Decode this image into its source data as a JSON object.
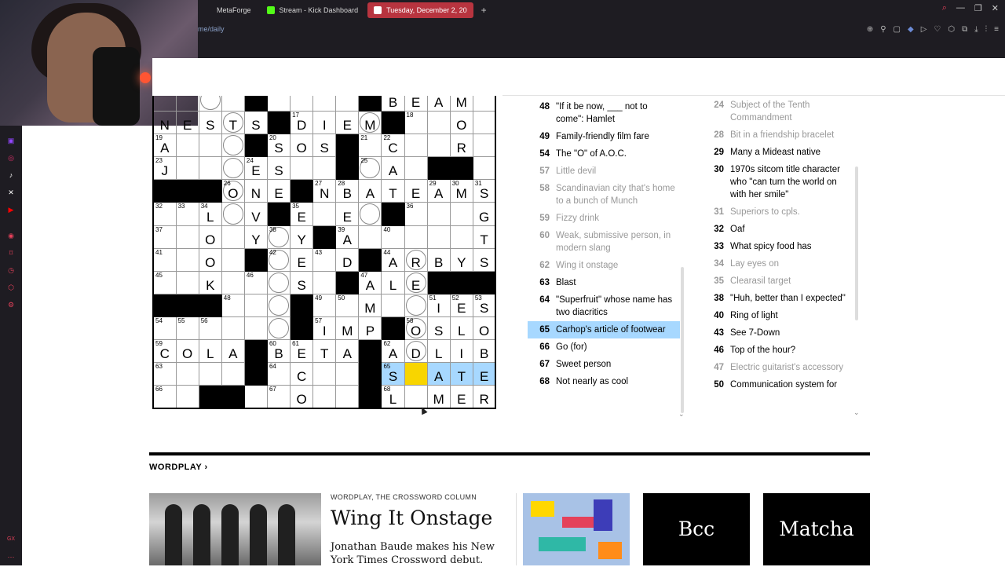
{
  "browser": {
    "tabs": [
      {
        "label": "MetaForge",
        "active": false,
        "icon": "page-icon"
      },
      {
        "label": "Stream - Kick Dashboard",
        "active": false,
        "icon": "kick-icon"
      },
      {
        "label": "Tuesday, December 2, 20",
        "active": true,
        "icon": "nyt-icon"
      }
    ],
    "url": "me/daily",
    "accent_color": "#b8343f"
  },
  "grid": {
    "rows": [
      [
        "",
        "O",
        "",
        "B",
        "",
        "",
        "",
        "",
        "B",
        "E",
        "A",
        "M"
      ],
      [
        "N|E",
        "S",
        "T|O",
        "S",
        "#",
        "D|17",
        "I",
        "E",
        "M|O",
        "#",
        "|18",
        "O"
      ],
      [
        "A|19",
        "",
        "O",
        "#",
        "S|20",
        "O",
        "S",
        "#|21",
        "C|22",
        "",
        "",
        "R"
      ],
      [
        "J|23",
        "",
        "O",
        "E|24",
        "S",
        "",
        "",
        "#",
        "A|25",
        "",
        "#",
        "#"
      ],
      [
        "#",
        "#",
        "#",
        "O|26",
        "N",
        "E",
        "#",
        "N|27",
        "B|28",
        "A",
        "T",
        "E",
        "A|29",
        "M|30",
        "S|31"
      ],
      [
        "",
        "",
        "",
        "",
        "",
        "",
        "",
        "",
        "",
        "",
        "",
        ""
      ]
    ],
    "active_clue_number": "65",
    "active_answer_visible": [
      "S",
      "",
      "A",
      "T",
      "E"
    ]
  },
  "across_clues": [
    {
      "num": "48",
      "text": "\"If it be now, ___ not to come\": Hamlet",
      "state": "normal"
    },
    {
      "num": "49",
      "text": "Family-friendly film fare",
      "state": "normal"
    },
    {
      "num": "54",
      "text": "The \"O\" of A.O.C.",
      "state": "normal"
    },
    {
      "num": "57",
      "text": "Little devil",
      "state": "dim"
    },
    {
      "num": "58",
      "text": "Scandinavian city that's home to a bunch of Munch",
      "state": "dim"
    },
    {
      "num": "59",
      "text": "Fizzy drink",
      "state": "dim"
    },
    {
      "num": "60",
      "text": "Weak, submissive person, in modern slang",
      "state": "dim"
    },
    {
      "num": "62",
      "text": "Wing it onstage",
      "state": "dim"
    },
    {
      "num": "63",
      "text": "Blast",
      "state": "normal"
    },
    {
      "num": "64",
      "text": "\"Superfruit\" whose name has two diacritics",
      "state": "normal"
    },
    {
      "num": "65",
      "text": "Carhop's article of footwear",
      "state": "selected"
    },
    {
      "num": "66",
      "text": "Go (for)",
      "state": "normal"
    },
    {
      "num": "67",
      "text": "Sweet person",
      "state": "normal"
    },
    {
      "num": "68",
      "text": "Not nearly as cool",
      "state": "normal"
    }
  ],
  "down_clues": [
    {
      "num": "24",
      "text": "Subject of the Tenth Commandment",
      "state": "dim"
    },
    {
      "num": "28",
      "text": "Bit in a friendship bracelet",
      "state": "dim"
    },
    {
      "num": "29",
      "text": "Many a Mideast native",
      "state": "normal"
    },
    {
      "num": "30",
      "text": "1970s sitcom title character who \"can turn the world on with her smile\"",
      "state": "normal"
    },
    {
      "num": "31",
      "text": "Superiors to cpls.",
      "state": "dim"
    },
    {
      "num": "32",
      "text": "Oaf",
      "state": "normal"
    },
    {
      "num": "33",
      "text": "What spicy food has",
      "state": "normal"
    },
    {
      "num": "34",
      "text": "Lay eyes on",
      "state": "dim"
    },
    {
      "num": "35",
      "text": "Clearasil target",
      "state": "dim"
    },
    {
      "num": "38",
      "text": "\"Huh, better than I expected\"",
      "state": "normal"
    },
    {
      "num": "40",
      "text": "Ring of light",
      "state": "normal"
    },
    {
      "num": "43",
      "text": "See 7-Down",
      "state": "normal"
    },
    {
      "num": "46",
      "text": "Top of the hour?",
      "state": "normal"
    },
    {
      "num": "47",
      "text": "Electric guitarist's accessory",
      "state": "dim"
    },
    {
      "num": "50",
      "text": "Communication system for",
      "state": "normal"
    }
  ],
  "wordplay": {
    "section_label": "WORDPLAY",
    "section_arrow": "›",
    "kicker": "WORDPLAY, THE CROSSWORD COLUMN",
    "headline": "Wing It Onstage",
    "dek": "Jonathan Baude makes his New York Times Crossword debut.",
    "tiles": [
      "Bcc",
      "Matcha"
    ]
  }
}
